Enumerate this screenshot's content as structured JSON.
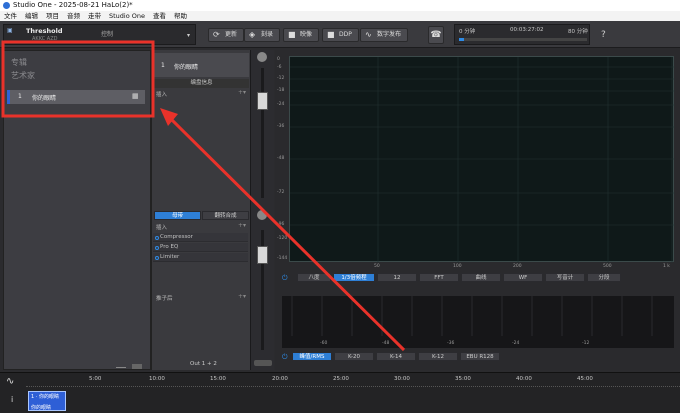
{
  "window": {
    "title": "Studio One - 2025-08-21 HaLo(2)*"
  },
  "menu": [
    "文件",
    "编辑",
    "项目",
    "音频",
    "走带",
    "Studio One",
    "查看",
    "帮助"
  ],
  "toolbar": {
    "preset_name": "Threshold",
    "preset_sub": "AKKC AZD",
    "control_label": "控制",
    "buttons": [
      {
        "label": "更新",
        "icon": "refresh-icon"
      },
      {
        "label": "刻录",
        "icon": "burn-icon"
      },
      {
        "label": "映像",
        "icon": "disc-image-icon"
      },
      {
        "label": "DDP",
        "icon": "ddp-icon"
      },
      {
        "label": "数字发布",
        "icon": "waveform-icon"
      }
    ],
    "time_start": "0 分钟",
    "time_current": "00:03:27:02",
    "time_end": "80 分钟",
    "help": "?"
  },
  "left_panel": {
    "album_label": "专辑",
    "artist_label": "艺术家",
    "track_number": "1",
    "track_name": "你的眼睛"
  },
  "mid_panel": {
    "track_number": "1",
    "track_name": "你的眼睛",
    "tab_label": "编盘信息",
    "inserts_label": "插入",
    "bottom_tabs": [
      "母带",
      "翻转合成"
    ],
    "master_inserts_label": "插入",
    "plugins": [
      "Compressor",
      "Pro EQ",
      "Limiter"
    ],
    "subgroup_label": "推子后",
    "footer": "Out 1 + 2"
  },
  "analyzer": {
    "db_ticks": [
      "0",
      "-6",
      "-12",
      "-18",
      "-24",
      "-36",
      "-48",
      "-72",
      "-96",
      "-120",
      "-144"
    ],
    "freq_ticks": [
      "50",
      "100",
      "200",
      "500",
      "1 k"
    ],
    "mode_tabs": [
      "八度",
      "1/3倍频程",
      "12",
      "FFT",
      "曲线",
      "WF",
      "写音计",
      "分段"
    ],
    "active_mode": "1/3倍频程",
    "meter_ticks": [
      "-60",
      "-48",
      "-36",
      "-24",
      "-12"
    ],
    "meter_tabs": [
      "峰值/RMS",
      "K-20",
      "K-14",
      "K-12",
      "EBU R128"
    ],
    "active_meter": "峰值/RMS"
  },
  "timeline": {
    "ticks": [
      "5:00",
      "10:00",
      "15:00",
      "20:00",
      "25:00",
      "30:00",
      "35:00",
      "40:00",
      "45:00"
    ],
    "clip_label": "1 · 你的眼睛",
    "clip_sub": "你的眼睛"
  }
}
